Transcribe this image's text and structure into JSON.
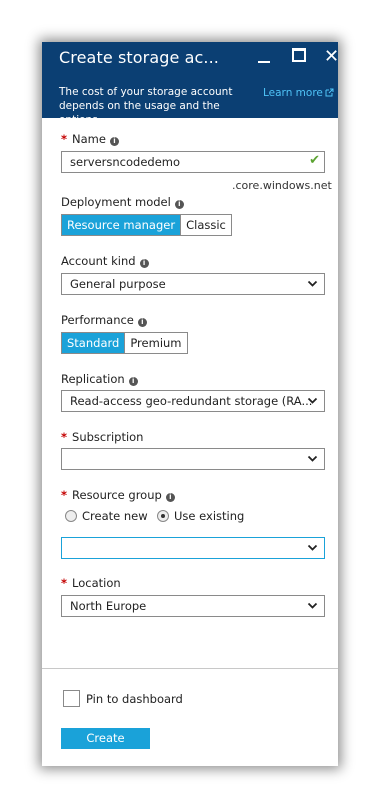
{
  "header": {
    "title": "Create storage ac...",
    "close_glyph": "✕",
    "subtitle": "The cost of your storage account depends on the usage and the options",
    "learn_more": "Learn more"
  },
  "form": {
    "name": {
      "label": "Name",
      "value": "serversncodedemo",
      "suffix": ".core.windows.net",
      "valid": true
    },
    "deployment_model": {
      "label": "Deployment model",
      "options": [
        "Resource manager",
        "Classic"
      ],
      "selected": "Resource manager"
    },
    "account_kind": {
      "label": "Account kind",
      "value": "General purpose"
    },
    "performance": {
      "label": "Performance",
      "options": [
        "Standard",
        "Premium"
      ],
      "selected": "Standard"
    },
    "replication": {
      "label": "Replication",
      "value": "Read-access geo-redundant storage (RA..."
    },
    "subscription": {
      "label": "Subscription",
      "value": ""
    },
    "resource_group": {
      "label": "Resource group",
      "options": [
        "Create new",
        "Use existing"
      ],
      "selected": "Use existing",
      "value": ""
    },
    "location": {
      "label": "Location",
      "value": "North Europe"
    }
  },
  "footer": {
    "pin_label": "Pin to dashboard",
    "pin_checked": false,
    "create_label": "Create"
  },
  "colors": {
    "header_bg": "#0b3f73",
    "accent": "#1aa2d9",
    "required": "#c40000",
    "link": "#4fc3f7",
    "valid_check": "#5ba331"
  },
  "icons": {
    "required": "asterisk",
    "info": "info-icon",
    "dropdown": "chevron-down-icon",
    "valid": "checkmark-icon",
    "external": "external-link-icon"
  }
}
